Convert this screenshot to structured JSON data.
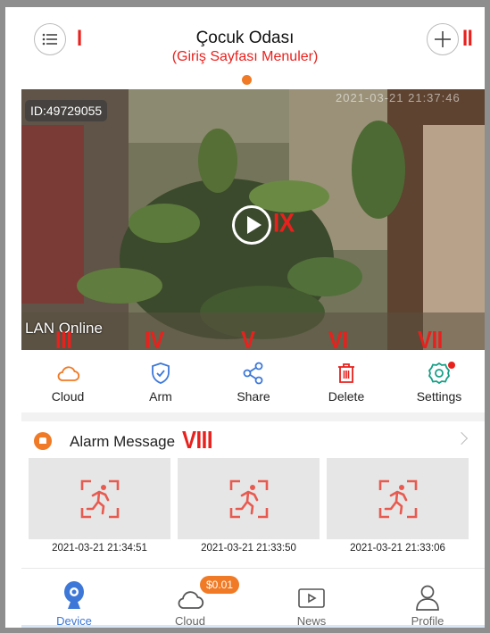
{
  "header": {
    "title": "Çocuk Odası",
    "subtitle": "(Giriş Sayfası Menuler)",
    "menu_icon": "list-icon",
    "add_icon": "plus-icon"
  },
  "annotations": {
    "I": "I",
    "II": "II",
    "III": "III",
    "IV": "IV",
    "V": "V",
    "VI": "VI",
    "VII": "VII",
    "VIII": "VIII",
    "IX": "IX"
  },
  "camera": {
    "id_label": "ID:49729055",
    "status": "LAN Online",
    "timestamp": "2021-03-21 21:37:46"
  },
  "actions": [
    {
      "label": "Cloud",
      "icon": "cloud-icon",
      "color": "#f07a25"
    },
    {
      "label": "Arm",
      "icon": "shield-icon",
      "color": "#3d78d8"
    },
    {
      "label": "Share",
      "icon": "share-icon",
      "color": "#3d78d8"
    },
    {
      "label": "Delete",
      "icon": "trash-icon",
      "color": "#e8211d"
    },
    {
      "label": "Settings",
      "icon": "gear-icon",
      "color": "#17a086"
    }
  ],
  "alarm": {
    "title": "Alarm Message",
    "items": [
      {
        "time": "2021-03-21 21:34:51",
        "icon": "motion-detect-icon"
      },
      {
        "time": "2021-03-21 21:33:50",
        "icon": "motion-detect-icon"
      },
      {
        "time": "2021-03-21 21:33:06",
        "icon": "motion-detect-icon"
      }
    ]
  },
  "nav": {
    "items": [
      {
        "label": "Device",
        "icon": "camera-icon",
        "active": true
      },
      {
        "label": "Cloud",
        "icon": "cloud-icon",
        "active": false
      },
      {
        "label": "News",
        "icon": "video-play-icon",
        "active": false
      },
      {
        "label": "Profile",
        "icon": "person-icon",
        "active": false
      }
    ],
    "cloud_badge": "$0.01"
  },
  "colors": {
    "accent": "#f07a25",
    "annotation": "#e8211d",
    "active": "#3d78d8"
  }
}
